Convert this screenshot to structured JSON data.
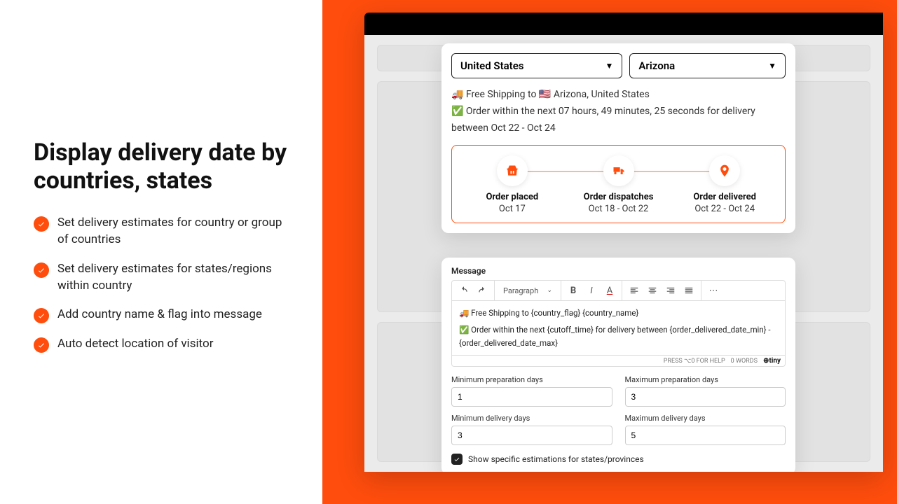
{
  "left": {
    "title": "Display delivery date by countries, states",
    "features": [
      "Set delivery estimates for country or group of countries",
      "Set delivery estimates for states/regions within country",
      "Add country name & flag into message",
      "Auto detect location of visitor"
    ]
  },
  "preview": {
    "country": "United States",
    "state": "Arizona",
    "shipping_line": "🚚 Free Shipping to 🇺🇸 Arizona, United States",
    "cutoff_line": "✅ Order within the next 07 hours, 49 minutes, 25 seconds for delivery between Oct 22 - Oct 24",
    "steps": [
      {
        "label": "Order placed",
        "date": "Oct 17"
      },
      {
        "label": "Order dispatches",
        "date": "Oct 18 - Oct 22"
      },
      {
        "label": "Order delivered",
        "date": "Oct 22 - Oct 24"
      }
    ]
  },
  "editor": {
    "section_label": "Message",
    "paragraph_label": "Paragraph",
    "body_line1": "🚚 Free Shipping to {country_flag} {country_name}",
    "body_line2": "✅ Order within the next {cutoff_time} for delivery between {order_delivered_date_min} - {order_delivered_date_max}",
    "help_text": "PRESS ⌥0 FOR HELP",
    "word_count": "0 WORDS",
    "tiny": "⊕tiny",
    "fields": {
      "min_prep_label": "Minimum preparation days",
      "min_prep_value": "1",
      "max_prep_label": "Maximum preparation days",
      "max_prep_value": "3",
      "min_del_label": "Minimum delivery days",
      "min_del_value": "3",
      "max_del_label": "Maximum delivery days",
      "max_del_value": "5"
    },
    "checkbox_label": "Show specific estimations for states/provinces"
  }
}
